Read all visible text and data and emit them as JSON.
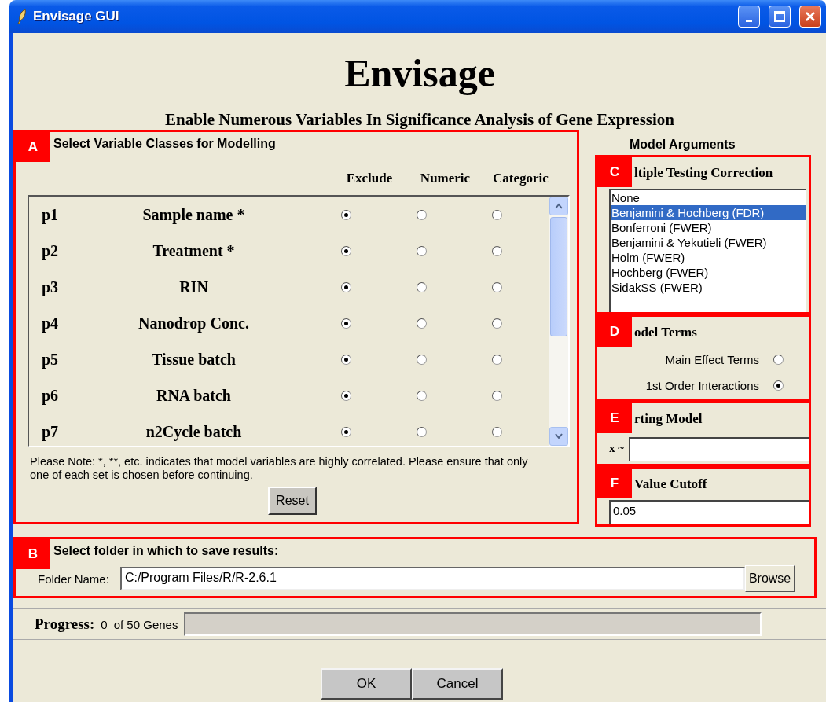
{
  "window": {
    "title": "Envisage GUI"
  },
  "header": {
    "title": "Envisage",
    "subtitle": "Enable Numerous Variables In Significance Analysis of Gene Expression"
  },
  "variable_classes": {
    "annotation": "A",
    "legend": "Select Variable Classes for Modelling",
    "columns": [
      "Exclude",
      "Numeric",
      "Categoric"
    ],
    "rows": [
      {
        "param": "p1",
        "name": "Sample name *",
        "options": [
          {
            "selected": true
          },
          {
            "selected": false
          },
          {
            "selected": false
          }
        ]
      },
      {
        "param": "p2",
        "name": "Treatment *",
        "options": [
          {
            "selected": true
          },
          {
            "selected": false
          },
          {
            "selected": false
          }
        ]
      },
      {
        "param": "p3",
        "name": "RIN",
        "options": [
          {
            "selected": true
          },
          {
            "selected": false
          },
          {
            "selected": false
          }
        ]
      },
      {
        "param": "p4",
        "name": "Nanodrop Conc.",
        "options": [
          {
            "selected": true
          },
          {
            "selected": false
          },
          {
            "selected": false
          }
        ]
      },
      {
        "param": "p5",
        "name": "Tissue batch",
        "options": [
          {
            "selected": true
          },
          {
            "selected": false
          },
          {
            "selected": false
          }
        ]
      },
      {
        "param": "p6",
        "name": "RNA batch",
        "options": [
          {
            "selected": true
          },
          {
            "selected": false
          },
          {
            "selected": false
          }
        ]
      },
      {
        "param": "p7",
        "name": "n2Cycle batch",
        "options": [
          {
            "selected": true
          },
          {
            "selected": false
          },
          {
            "selected": false
          }
        ]
      }
    ],
    "note": "Please Note: *, **, etc. indicates that model variables are highly correlated. Please ensure that only one of each set is chosen before continuing.",
    "reset_button": "Reset"
  },
  "model_arguments": {
    "legend": "Model Arguments",
    "correction": {
      "annotation": "C",
      "heading": "ltiple Testing Correction",
      "options": [
        {
          "label": "None",
          "selected": false
        },
        {
          "label": "Benjamini & Hochberg (FDR)",
          "selected": true
        },
        {
          "label": "Bonferroni (FWER)",
          "selected": false
        },
        {
          "label": "Benjamini & Yekutieli (FWER)",
          "selected": false
        },
        {
          "label": "Holm (FWER)",
          "selected": false
        },
        {
          "label": "Hochberg (FWER)",
          "selected": false
        },
        {
          "label": "SidakSS (FWER)",
          "selected": false
        }
      ]
    },
    "model_terms": {
      "annotation": "D",
      "heading": "odel Terms",
      "options": [
        {
          "label": "Main Effect Terms",
          "selected": false
        },
        {
          "label": "1st Order Interactions",
          "selected": true
        }
      ]
    },
    "starting_model": {
      "annotation": "E",
      "heading": "rting Model",
      "prefix": "x ~"
    },
    "cutoff": {
      "annotation": "F",
      "heading": "Value Cutoff",
      "value": "0.05"
    }
  },
  "output_folder": {
    "annotation": "B",
    "legend": "Select folder in which to save results:",
    "label": "Folder Name:",
    "value": "C:/Program Files/R/R-2.6.1",
    "browse_button": "Browse"
  },
  "progress": {
    "label": "Progress:",
    "count": "0",
    "total": "of 50 Genes",
    "level": 0
  },
  "buttons": [
    "OK",
    "Cancel"
  ]
}
